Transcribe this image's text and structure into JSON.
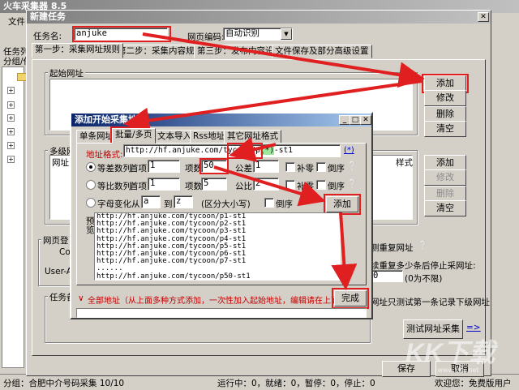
{
  "main_window": {
    "title": "火车采集器 8.5",
    "menu_first": "文件(",
    "sidebar_tab": "任务列",
    "sidebar_header": "分组/任"
  },
  "status_bar": {
    "left": "分组：合肥中介号码采集   10/10",
    "middle": "运行中：0，就绪：0，暂停：0，停止：0",
    "right": "欢迎您：免费版用户"
  },
  "new_task": {
    "title": "新建任务",
    "task_name_label": "任务名:",
    "task_name_value": "anjuke",
    "encoding_label": "网页编码:",
    "encoding_value": "自动识别",
    "tabs": [
      "第一步：采集网址规则",
      "第二步：采集内容规则",
      "第三步：发布内容设置",
      "文件保存及部分高级设置"
    ],
    "start_url_group": "起始网址",
    "start_buttons": [
      "添加",
      "修改",
      "删除",
      "清空"
    ],
    "multi_group": "多级网",
    "multi_header_left": "网址",
    "multi_header_right": "样式",
    "multi_buttons": [
      "添加",
      "修改",
      "删除",
      "清空"
    ],
    "page_group_label": "网页登",
    "page_cookie_label": "Coo",
    "page_ua_label": "User-A",
    "dup_label": "测重复网址",
    "stop_label": "续重复多少条后停止采网址:",
    "stop_value": "0",
    "stop_hint": "(0为不限)",
    "task_note_label": "任务备",
    "test_hint": "网址只测试第一条记录下级网址",
    "test_button": "测试网址采集",
    "test_arrows": "=>",
    "save_button": "保存",
    "cancel_button": "取消"
  },
  "dialog": {
    "title": "添加开始采集地址",
    "tabs": [
      "单条网址",
      "批量/多页",
      "文本导入",
      "Rss地址",
      "其它网址格式"
    ],
    "addr_label": "地址格式:",
    "addr_value": "http://hf.anjuke.com/tycoon/p(*)-st1",
    "addr_value_pre": "http://hf.anjuke.com/tycoon/p",
    "addr_value_wild": "(*)",
    "addr_value_post": "-st1",
    "wildcard_link": "(*)",
    "row1": {
      "label": "等差数列",
      "first_label": "首项",
      "first": "1",
      "count_label": "项数",
      "count": "50",
      "diff_label": "公差",
      "diff": "1",
      "pad_label": "补零",
      "rev_label": "倒序"
    },
    "row2": {
      "label": "等比数列",
      "first_label": "首项",
      "first": "1",
      "count_label": "项数",
      "count": "5",
      "ratio_label": "公比",
      "ratio": "2",
      "pad_label": "补零",
      "rev_label": "倒序"
    },
    "row3": {
      "label": "字母变化",
      "from_label": "从",
      "from": "a",
      "to_label": "到",
      "to": "z",
      "case_note": "(区分大小写)",
      "rev_label": "倒序"
    },
    "add_button": "添加",
    "preview_label": "预览",
    "preview_lines": [
      "http://hf.anjuke.com/tycoon/p1-st1",
      "http://hf.anjuke.com/tycoon/p2-st1",
      "http://hf.anjuke.com/tycoon/p3-st1",
      "http://hf.anjuke.com/tycoon/p4-st1",
      "http://hf.anjuke.com/tycoon/p5-st1",
      "http://hf.anjuke.com/tycoon/p6-st1",
      "http://hf.anjuke.com/tycoon/p7-st1",
      "......",
      "http://hf.anjuke.com/tycoon/p50-st1"
    ],
    "footer_note": "全部地址（从上面多种方式添加，一次性加入起始地址，编辑请在上面右击）",
    "done_button": "完成"
  },
  "watermark": "KK下载",
  "watermark_small": "www.kkx.net",
  "colors": {
    "arrow": "#e02020",
    "title_active": "#0a246a",
    "url_link": "#0000cc"
  }
}
